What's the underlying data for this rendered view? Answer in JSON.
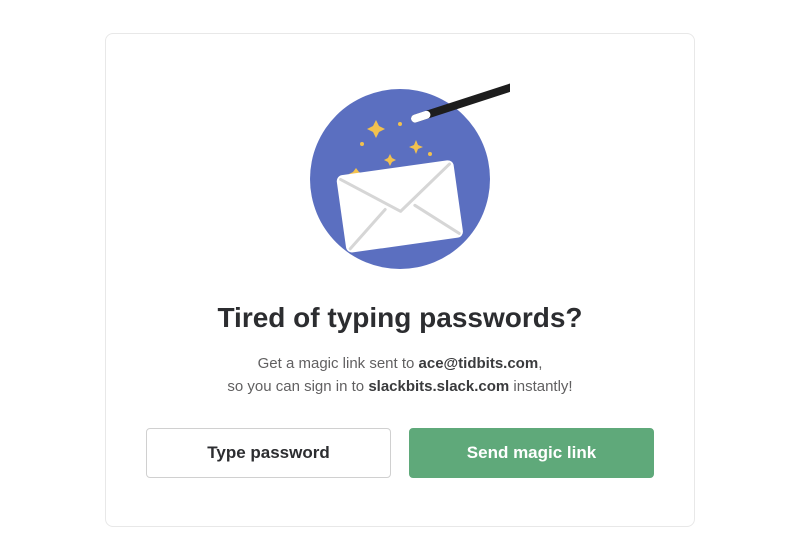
{
  "heading": "Tired of typing passwords?",
  "subtext_1a": "Get a magic link sent to ",
  "subtext_1b": "ace@tidbits.com",
  "subtext_1c_comma": ",",
  "subtext_2a": "so you can sign in to ",
  "subtext_2b": "slackbits.slack.com",
  "subtext_2c": " instantly!",
  "buttons": {
    "secondary": "Type password",
    "primary": "Send magic link"
  },
  "colors": {
    "primary_button": "#5fa97a",
    "circle": "#5b6fc0"
  }
}
